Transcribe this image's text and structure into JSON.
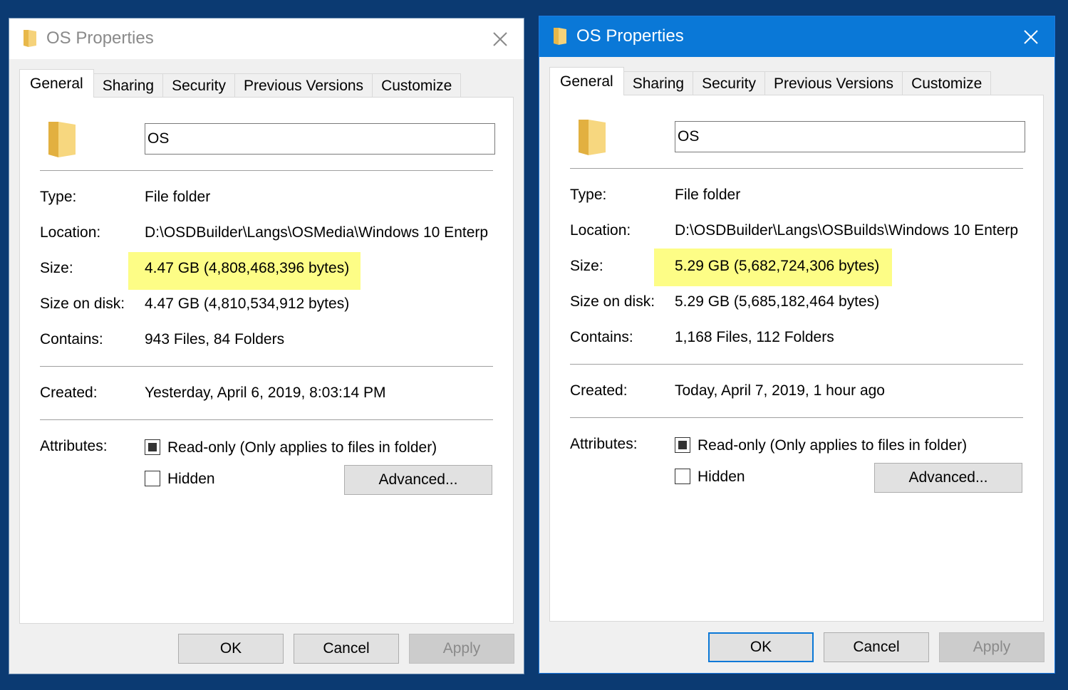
{
  "dialogs": [
    {
      "title": "OS Properties",
      "tabs": [
        "General",
        "Sharing",
        "Security",
        "Previous Versions",
        "Customize"
      ],
      "name_value": "OS",
      "type_label": "Type:",
      "type_value": "File folder",
      "location_label": "Location:",
      "location_value": "D:\\OSDBuilder\\Langs\\OSMedia\\Windows 10 Enterp",
      "size_label": "Size:",
      "size_value": "4.47 GB (4,808,468,396 bytes)",
      "size_on_disk_label": "Size on disk:",
      "size_on_disk_value": "4.47 GB (4,810,534,912 bytes)",
      "contains_label": "Contains:",
      "contains_value": "943 Files, 84 Folders",
      "created_label": "Created:",
      "created_value": "Yesterday, April 6, 2019, 8:03:14 PM",
      "attributes_label": "Attributes:",
      "readonly_label": "Read-only (Only applies to files in folder)",
      "hidden_label": "Hidden",
      "advanced_label": "Advanced...",
      "ok_label": "OK",
      "cancel_label": "Cancel",
      "apply_label": "Apply"
    },
    {
      "title": "OS Properties",
      "tabs": [
        "General",
        "Sharing",
        "Security",
        "Previous Versions",
        "Customize"
      ],
      "name_value": "OS",
      "type_label": "Type:",
      "type_value": "File folder",
      "location_label": "Location:",
      "location_value": "D:\\OSDBuilder\\Langs\\OSBuilds\\Windows 10 Enterp",
      "size_label": "Size:",
      "size_value": "5.29 GB (5,682,724,306 bytes)",
      "size_on_disk_label": "Size on disk:",
      "size_on_disk_value": "5.29 GB (5,685,182,464 bytes)",
      "contains_label": "Contains:",
      "contains_value": "1,168 Files, 112 Folders",
      "created_label": "Created:",
      "created_value": "Today, April 7, 2019, 1 hour ago",
      "attributes_label": "Attributes:",
      "readonly_label": "Read-only (Only applies to files in folder)",
      "hidden_label": "Hidden",
      "advanced_label": "Advanced...",
      "ok_label": "OK",
      "cancel_label": "Cancel",
      "apply_label": "Apply"
    }
  ],
  "icons": {
    "title": "folder-icon",
    "close": "close-icon",
    "main": "folder-icon"
  },
  "colors": {
    "desktop": "#0b3a72",
    "active_titlebar": "#0a78d7",
    "highlight": "#fdfd86"
  }
}
